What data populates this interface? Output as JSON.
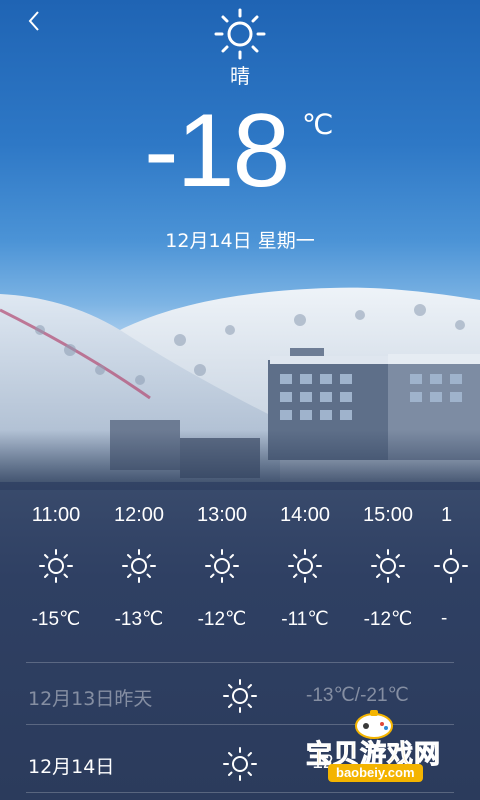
{
  "header": {
    "condition": "晴",
    "temperature": "-18",
    "unit": "℃",
    "date": "12月14日",
    "weekday": "星期一",
    "icon": "sun-icon"
  },
  "hourly": [
    {
      "time": "11:00",
      "temp": "-15℃",
      "icon": "sun-icon"
    },
    {
      "time": "12:00",
      "temp": "-13℃",
      "icon": "sun-icon"
    },
    {
      "time": "13:00",
      "temp": "-12℃",
      "icon": "sun-icon"
    },
    {
      "time": "14:00",
      "temp": "-11℃",
      "icon": "sun-icon"
    },
    {
      "time": "15:00",
      "temp": "-12℃",
      "icon": "sun-icon"
    },
    {
      "time": "1",
      "temp": "-",
      "icon": "sun-icon"
    }
  ],
  "daily": [
    {
      "date": "12月13日昨天",
      "range": "-13℃/-21℃",
      "icon": "sun-icon"
    },
    {
      "date": "12月14日",
      "range": "-12",
      "icon": "sun-icon"
    }
  ],
  "watermark": {
    "text": "宝贝游戏网",
    "url": "baobeiy.com"
  },
  "colors": {
    "sky_top": "#1f64b4",
    "panel": "#2f4063",
    "watermark": "#f4b400"
  }
}
